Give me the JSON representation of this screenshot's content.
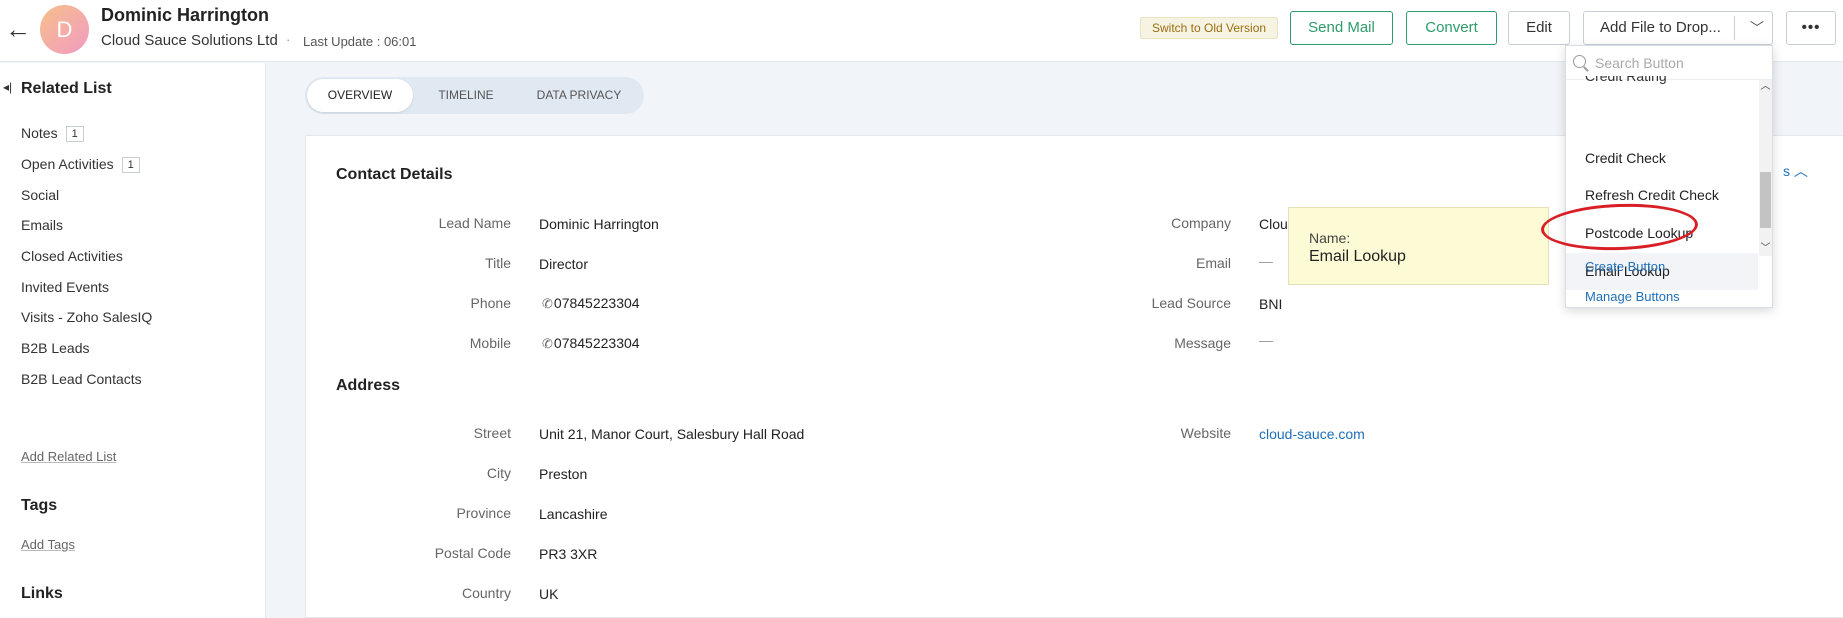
{
  "header": {
    "back_icon": "arrow-left-icon",
    "avatar_initial": "D",
    "name": "Dominic Harrington",
    "company": "Cloud Sauce Solutions Ltd",
    "separator": "·",
    "last_update": "Last Update : 06:01",
    "switch_old": "Switch to Old Version",
    "send_mail": "Send Mail",
    "convert": "Convert",
    "edit": "Edit",
    "add_file": "Add File to Drop...",
    "more": "•••"
  },
  "sidebar": {
    "title": "Related List",
    "items": [
      {
        "label": "Notes",
        "count": "1"
      },
      {
        "label": "Open Activities",
        "count": "1"
      },
      {
        "label": "Social"
      },
      {
        "label": "Emails"
      },
      {
        "label": "Closed Activities"
      },
      {
        "label": "Invited Events"
      },
      {
        "label": "Visits - Zoho SalesIQ"
      },
      {
        "label": "B2B Leads"
      },
      {
        "label": "B2B Lead Contacts"
      }
    ],
    "add_related": "Add Related List",
    "tags_title": "Tags",
    "add_tags": "Add Tags",
    "links_title": "Links"
  },
  "tabs": [
    "OVERVIEW",
    "TIMELINE",
    "DATA PRIVACY"
  ],
  "contact": {
    "title": "Contact Details",
    "fields": {
      "lead_name": {
        "label": "Lead Name",
        "value": "Dominic Harrington"
      },
      "title": {
        "label": "Title",
        "value": "Director"
      },
      "phone": {
        "label": "Phone",
        "value": "07845223304"
      },
      "mobile": {
        "label": "Mobile",
        "value": "07845223304"
      },
      "company": {
        "label": "Company",
        "value": "Clou"
      },
      "email": {
        "label": "Email",
        "value": "—"
      },
      "lead_source": {
        "label": "Lead Source",
        "value": "BNI"
      },
      "message": {
        "label": "Message",
        "value": "—"
      }
    }
  },
  "address": {
    "title": "Address",
    "fields": {
      "street": {
        "label": "Street",
        "value": "Unit 21, Manor Court, Salesbury Hall Road"
      },
      "city": {
        "label": "City",
        "value": "Preston"
      },
      "province": {
        "label": "Province",
        "value": "Lancashire"
      },
      "postal": {
        "label": "Postal Code",
        "value": "PR3 3XR"
      },
      "country": {
        "label": "Country",
        "value": "UK"
      },
      "website": {
        "label": "Website",
        "value": "cloud-sauce.com"
      }
    }
  },
  "tooltip": {
    "label": "Name:",
    "value": "Email Lookup"
  },
  "dropdown": {
    "search_placeholder": "Search Button",
    "partial_item": "Credit Rating",
    "items": [
      "Credit Check",
      "Refresh Credit Check",
      "Postcode Lookup",
      "Email Lookup"
    ],
    "hovered": "Email Lookup",
    "create": "Create Button",
    "manage": "Manage Buttons"
  },
  "colors": {
    "accent": "#2e9b6a",
    "link": "#1f6fb8",
    "annotation": "#d81f26"
  }
}
